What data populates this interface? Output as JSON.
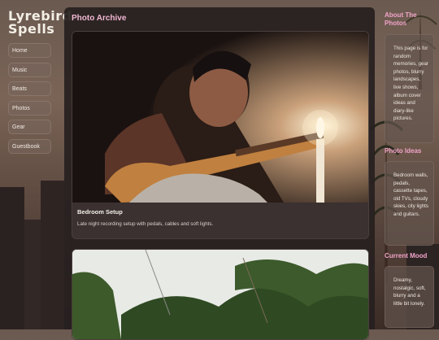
{
  "site": {
    "logo_line1": "Lyrebird",
    "logo_line2": "Spells"
  },
  "nav": {
    "items": [
      {
        "label": "Home"
      },
      {
        "label": "Music"
      },
      {
        "label": "Beats"
      },
      {
        "label": "Photos"
      },
      {
        "label": "Gear"
      },
      {
        "label": "Guestbook"
      }
    ]
  },
  "main": {
    "title": "Photo Archive",
    "cards": [
      {
        "title": "Bedroom Setup",
        "description": "Late night recording setup with pedals, cables and soft lights."
      },
      {
        "title": "",
        "description": ""
      }
    ]
  },
  "sidebar": {
    "about": {
      "heading": "About The Photos",
      "text": "This page is for random memories, gear photos, blurry landscapes, live shows, album cover ideas and diary-like pictures."
    },
    "ideas": {
      "heading": "Photo Ideas",
      "text": "Bedroom walls, pedals, cassette tapes, old TVs, cloudy skies, city lights and guitars."
    },
    "mood": {
      "heading": "Current Mood",
      "text": "Dreamy, nostalgic, soft, blurry and a little bit lonely."
    }
  },
  "colors": {
    "accent_pink": "#f1b7d2",
    "panel_bg": "#262020",
    "card_bg": "#3a3130"
  }
}
